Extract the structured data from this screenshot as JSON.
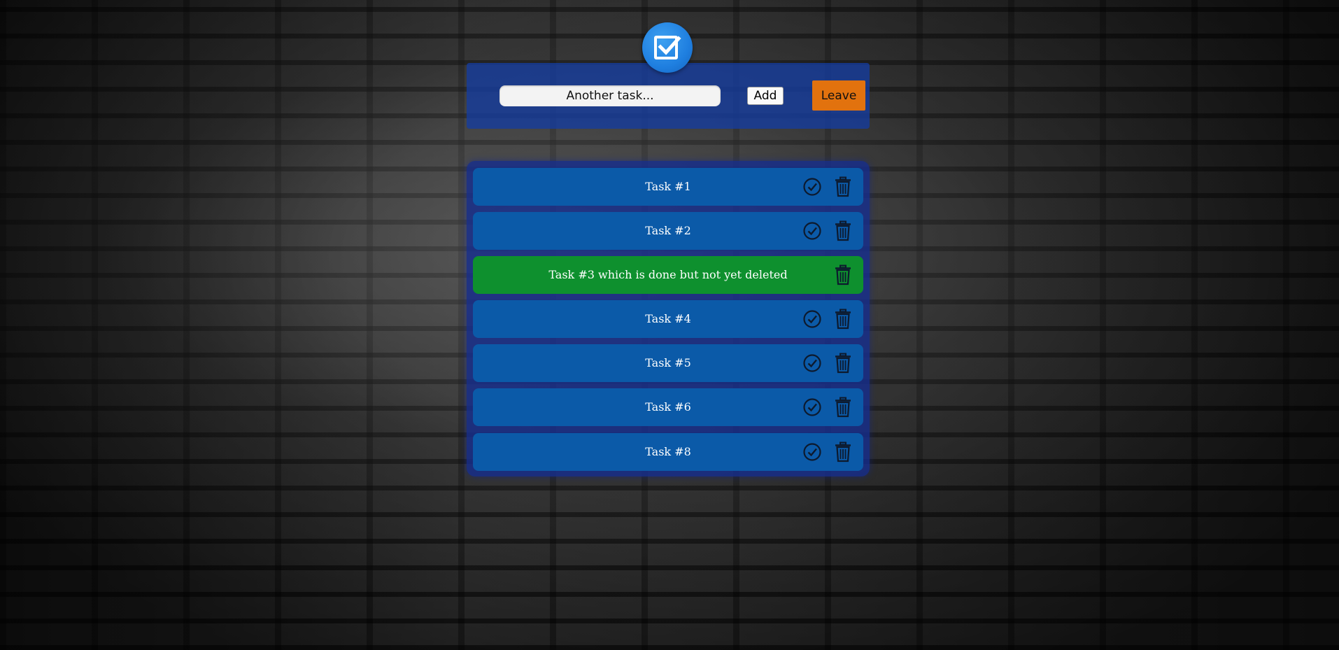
{
  "app": {
    "logo_icon": "checkbox-logo-icon"
  },
  "header": {
    "task_input": {
      "placeholder": "Another task...",
      "value": ""
    },
    "add_label": "Add",
    "leave_label": "Leave"
  },
  "colors": {
    "accent_blue": "#0b5aa8",
    "done_green": "#0e902e",
    "leave_orange": "#e2720e",
    "panel_navy": "#162d8c"
  },
  "icons": {
    "complete": "check-circle-icon",
    "delete": "trash-icon"
  },
  "tasks": [
    {
      "label": "Task #1",
      "done": false
    },
    {
      "label": "Task #2",
      "done": false
    },
    {
      "label": "Task #3 which is done but not yet deleted",
      "done": true
    },
    {
      "label": "Task #4",
      "done": false
    },
    {
      "label": "Task #5",
      "done": false
    },
    {
      "label": "Task #6",
      "done": false
    },
    {
      "label": "Task #8",
      "done": false
    }
  ]
}
